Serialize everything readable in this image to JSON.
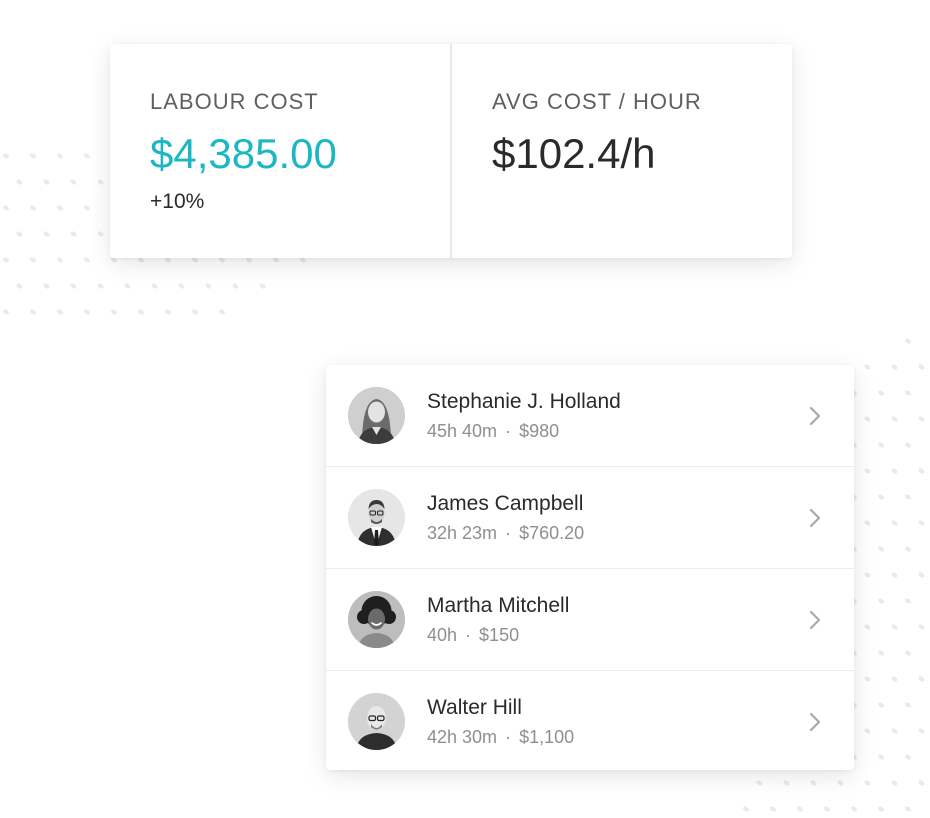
{
  "stats": [
    {
      "label": "LABOUR COST",
      "value": "$4,385.00",
      "change": "+10%"
    },
    {
      "label": "AVG COST / HOUR",
      "value": "$102.4/h"
    }
  ],
  "employees": [
    {
      "name": "Stephanie J. Holland",
      "hours": "45h 40m",
      "separator": "·",
      "cost": "$980",
      "avatar": "avatar-woman-long-hair"
    },
    {
      "name": "James Campbell",
      "hours": "32h 23m",
      "separator": "·",
      "cost": "$760.20",
      "avatar": "avatar-man-suit-glasses"
    },
    {
      "name": "Martha Mitchell",
      "hours": "40h",
      "separator": "·",
      "cost": "$150",
      "avatar": "avatar-woman-curly-hair"
    },
    {
      "name": "Walter Hill",
      "hours": "42h 30m",
      "separator": "·",
      "cost": "$1,100",
      "avatar": "avatar-man-bald-glasses"
    }
  ],
  "colors": {
    "accent": "#1bb8c4",
    "text": "#2a2a2a",
    "muted": "#8f8f8f",
    "decor_dots": "#e9eaee"
  },
  "icons": {
    "row_action": "chevron-right-icon"
  }
}
